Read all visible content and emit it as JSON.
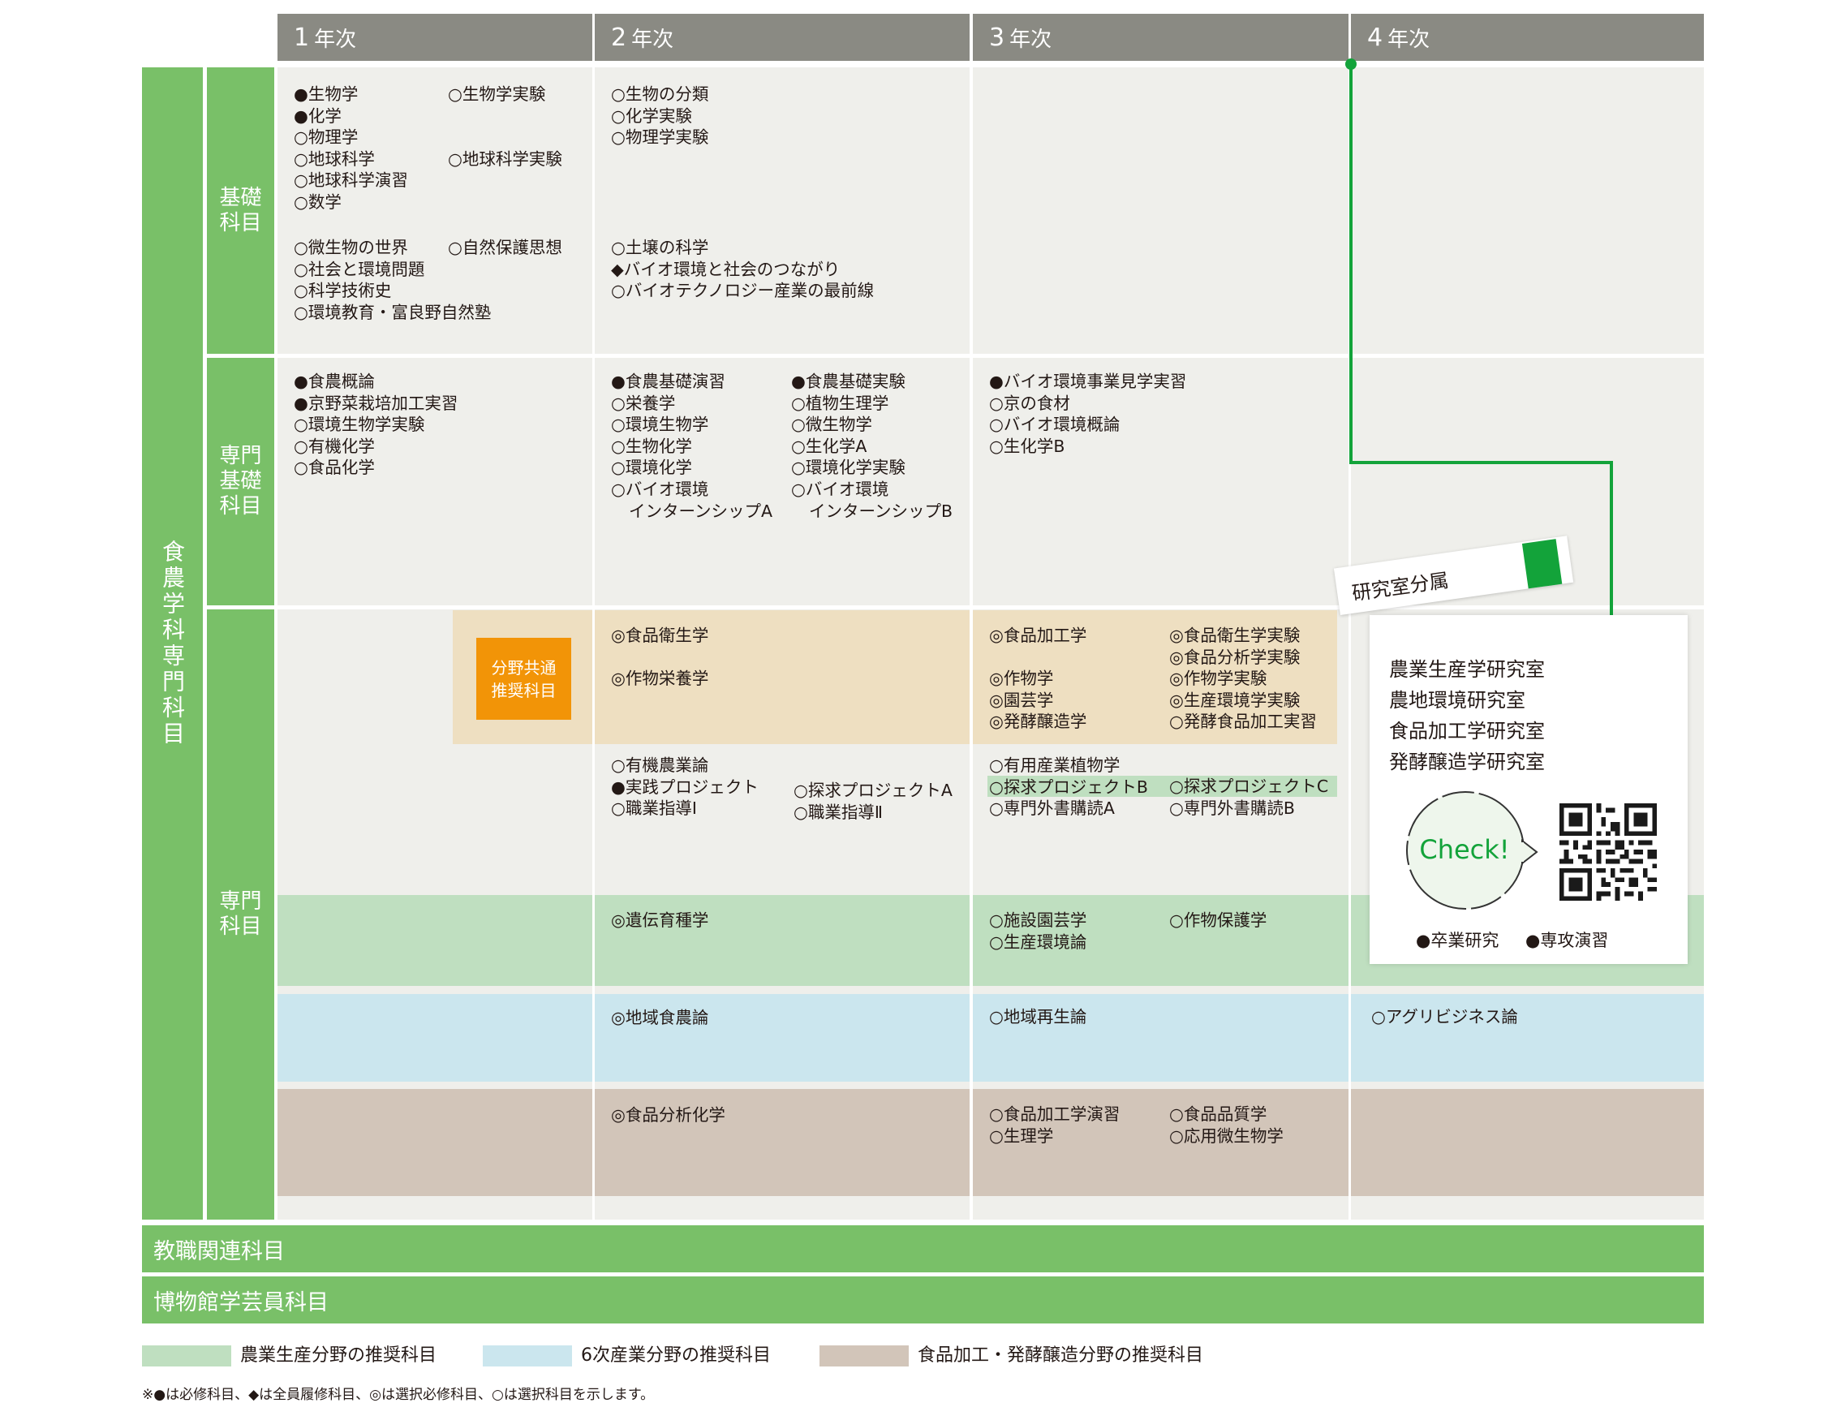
{
  "years": [
    {
      "num": "1",
      "suffix": "年次"
    },
    {
      "num": "2",
      "suffix": "年次"
    },
    {
      "num": "3",
      "suffix": "年次"
    },
    {
      "num": "4",
      "suffix": "年次"
    }
  ],
  "outer_label": "食農学科専門科目",
  "category_labels": [
    "基礎科目",
    "専門基礎科目",
    "専門科目"
  ],
  "basic": {
    "y1_left": [
      "●生物学",
      "●化学",
      "○物理学",
      "○地球科学",
      "○地球科学演習",
      "○数学"
    ],
    "y1_right_a": "○生物学実験",
    "y1_right_b": "○地球科学実験",
    "y1_lower_left": [
      "○微生物の世界",
      "○社会と環境問題",
      "○科学技術史",
      "○環境教育・富良野自然塾"
    ],
    "y1_lower_right": "○自然保護思想",
    "y2_upper": [
      "○生物の分類",
      "○化学実験",
      "○物理学実験"
    ],
    "y2_lower": [
      "○土壌の科学",
      "◆バイオ環境と社会のつながり",
      "○バイオテクノロジー産業の最前線"
    ]
  },
  "pro_basic": {
    "y1": [
      "●食農概論",
      "●京野菜栽培加工実習",
      "○環境生物学実験",
      "○有機化学",
      "○食品化学"
    ],
    "y2_left": [
      "●食農基礎演習",
      "○栄養学",
      "○環境生物学",
      "○生物化学",
      "○環境化学",
      "○バイオ環境",
      "インターンシップA"
    ],
    "y2_right": [
      "●食農基礎実験",
      "○植物生理学",
      "○微生物学",
      "○生化学A",
      "○環境化学実験",
      "○バイオ環境",
      "インターンシップB"
    ],
    "y3": [
      "●バイオ環境事業見学実習",
      "○京の食材",
      "○バイオ環境概論",
      "○生化学B"
    ]
  },
  "pro": {
    "shared_badge": "分野共通推奨科目",
    "orange_y2": [
      "◎食品衛生学",
      "◎作物栄養学"
    ],
    "orange_y3_left": [
      "◎食品加工学",
      "◎作物学",
      "◎園芸学",
      "◎発酵醸造学"
    ],
    "orange_y3_right": [
      "◎食品衛生学実験",
      "◎食品分析学実験",
      "◎作物学実験",
      "◎生産環境学実験",
      "○発酵食品加工実習"
    ],
    "general_y2_left": [
      "○有機農業論",
      "●実践プロジェクト",
      "○職業指導Ⅰ"
    ],
    "general_y2_right": [
      "○探求プロジェクトA",
      "○職業指導Ⅱ"
    ],
    "general_y3_left": [
      "○有用産業植物学",
      "○探求プロジェクトB",
      "○専門外書購読A"
    ],
    "general_y3_right": [
      "○探求プロジェクトC",
      "○専門外書購読B"
    ],
    "green_y2": "◎遺伝育種学",
    "green_y3_left": [
      "○施設園芸学",
      "○生産環境論"
    ],
    "green_y3_right": "○作物保護学",
    "blue_y2": "◎地域食農論",
    "blue_y3": "○地域再生論",
    "blue_y4": "○アグリビジネス論",
    "brown_y2": "◎食品分析化学",
    "brown_y3_left": [
      "○食品加工学演習",
      "○生理学"
    ],
    "brown_y3_right": [
      "○食品品質学",
      "○応用微生物学"
    ]
  },
  "lab": {
    "title": "研究室分属",
    "items": [
      "農業生産学研究室",
      "農地環境研究室",
      "食品加工学研究室",
      "発酵醸造学研究室"
    ],
    "check": "Check!",
    "footer": [
      "●卒業研究",
      "●専攻演習"
    ]
  },
  "bottom_bars": [
    "教職関連科目",
    "博物館学芸員科目"
  ],
  "legend": [
    "農業生産分野の推奨科目",
    "6次産業分野の推奨科目",
    "食品加工・発酵醸造分野の推奨科目"
  ],
  "note": "※●は必修科目、◆は全員履修科目、◎は選択必修科目、○は選択科目を示します。",
  "colors": {
    "header_gray": "#8a8a83",
    "accent_green": "#79c068",
    "line_green": "#13a33a",
    "orange_badge": "#f29407",
    "band_orange": "#eedfc1",
    "band_green": "#bfdfc0",
    "band_blue": "#cbe6ee",
    "band_brown": "#d2c5b9"
  }
}
